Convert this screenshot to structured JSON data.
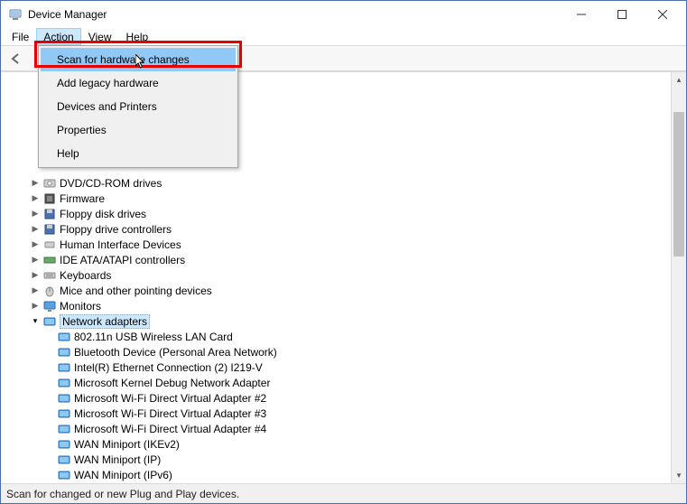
{
  "window": {
    "title": "Device Manager"
  },
  "menubar": {
    "file": "File",
    "action": "Action",
    "view": "View",
    "help": "Help"
  },
  "dropdown": {
    "scan_hardware": "Scan for hardware changes",
    "add_legacy": "Add legacy hardware",
    "devices_printers": "Devices and Printers",
    "properties": "Properties",
    "help": "Help"
  },
  "tree": {
    "dvd": "DVD/CD-ROM drives",
    "firmware": "Firmware",
    "floppy_disk": "Floppy disk drives",
    "floppy_ctrl": "Floppy drive controllers",
    "hid": "Human Interface Devices",
    "ide": "IDE ATA/ATAPI controllers",
    "keyboards": "Keyboards",
    "mice": "Mice and other pointing devices",
    "monitors": "Monitors",
    "network": "Network adapters",
    "net_children": {
      "wlan": "802.11n USB Wireless LAN Card",
      "bt": "Bluetooth Device (Personal Area Network)",
      "intel": "Intel(R) Ethernet Connection (2) I219-V",
      "mskernel": "Microsoft Kernel Debug Network Adapter",
      "wifi2": "Microsoft Wi-Fi Direct Virtual Adapter #2",
      "wifi3": "Microsoft Wi-Fi Direct Virtual Adapter #3",
      "wifi4": "Microsoft Wi-Fi Direct Virtual Adapter #4",
      "wan_ike": "WAN Miniport (IKEv2)",
      "wan_ip": "WAN Miniport (IP)",
      "wan_ipv6": "WAN Miniport (IPv6)"
    }
  },
  "statusbar": {
    "text": "Scan for changed or new Plug and Play devices."
  }
}
